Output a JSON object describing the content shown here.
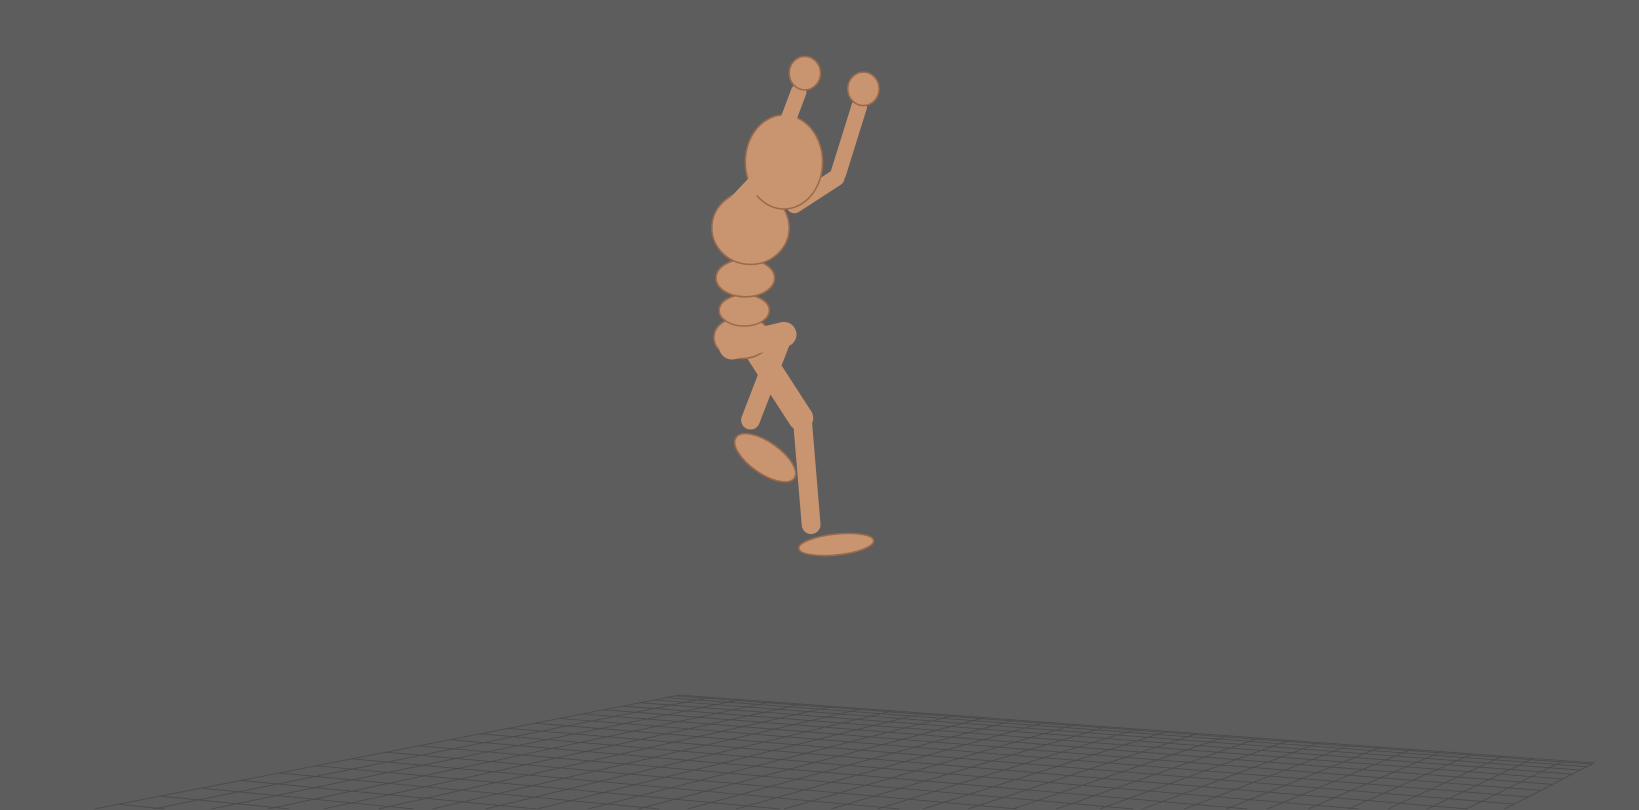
{
  "viewport": {
    "background_color": "#5d5d5d",
    "grid_color": "#4a4a4a",
    "model_color": "#c99470",
    "model_shadow_color": "#9a6a4c",
    "grid_divisions": 30
  }
}
